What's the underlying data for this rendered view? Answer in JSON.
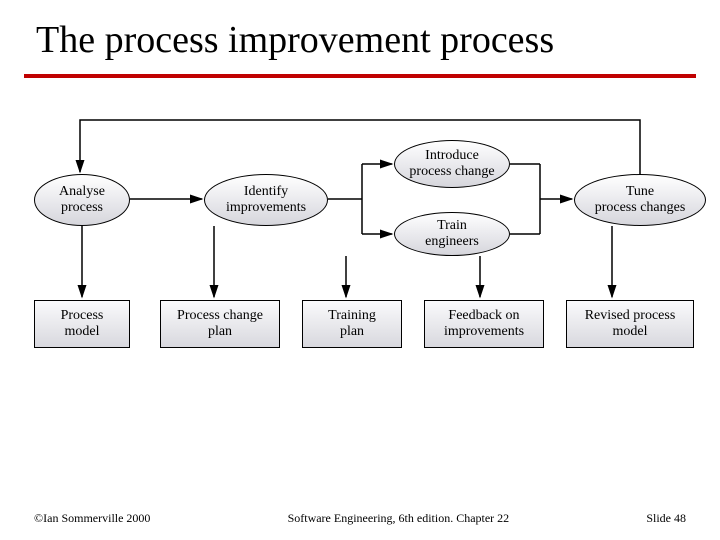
{
  "title": "The process improvement process",
  "footer": {
    "left": "©Ian Sommerville 2000",
    "center": "Software Engineering, 6th edition. Chapter 22",
    "right": "Slide 48"
  },
  "nodes": {
    "analyse": {
      "label": "Analyse\nprocess"
    },
    "identify": {
      "label": "Identify\nimprovements"
    },
    "introduce": {
      "label": "Introduce\nprocess change"
    },
    "train": {
      "label": "Train\nengineers"
    },
    "tune": {
      "label": "Tune\nprocess changes"
    }
  },
  "outputs": {
    "model": {
      "label": "Process\nmodel"
    },
    "plan": {
      "label": "Process change\nplan"
    },
    "training": {
      "label": "Training\nplan"
    },
    "feedback": {
      "label": "Feedback on\nimprovements"
    },
    "revised": {
      "label": "Revised process\nmodel"
    }
  },
  "chart_data": {
    "type": "flow",
    "steps": [
      {
        "id": "analyse",
        "label": "Analyse process",
        "output": "Process model"
      },
      {
        "id": "identify",
        "label": "Identify improvements",
        "output": "Process change plan"
      },
      {
        "id": "introduce",
        "label": "Introduce process change",
        "output": null
      },
      {
        "id": "train",
        "label": "Train engineers",
        "output": "Training plan"
      },
      {
        "id": "tune",
        "label": "Tune process changes",
        "output": "Revised process model"
      }
    ],
    "edges": [
      [
        "analyse",
        "identify"
      ],
      [
        "identify",
        "introduce"
      ],
      [
        "identify",
        "train"
      ],
      [
        "introduce",
        "tune"
      ],
      [
        "train",
        "tune"
      ],
      [
        "tune",
        "analyse"
      ],
      [
        "introduce+train",
        "feedback"
      ]
    ],
    "feedback_output": "Feedback on improvements"
  }
}
